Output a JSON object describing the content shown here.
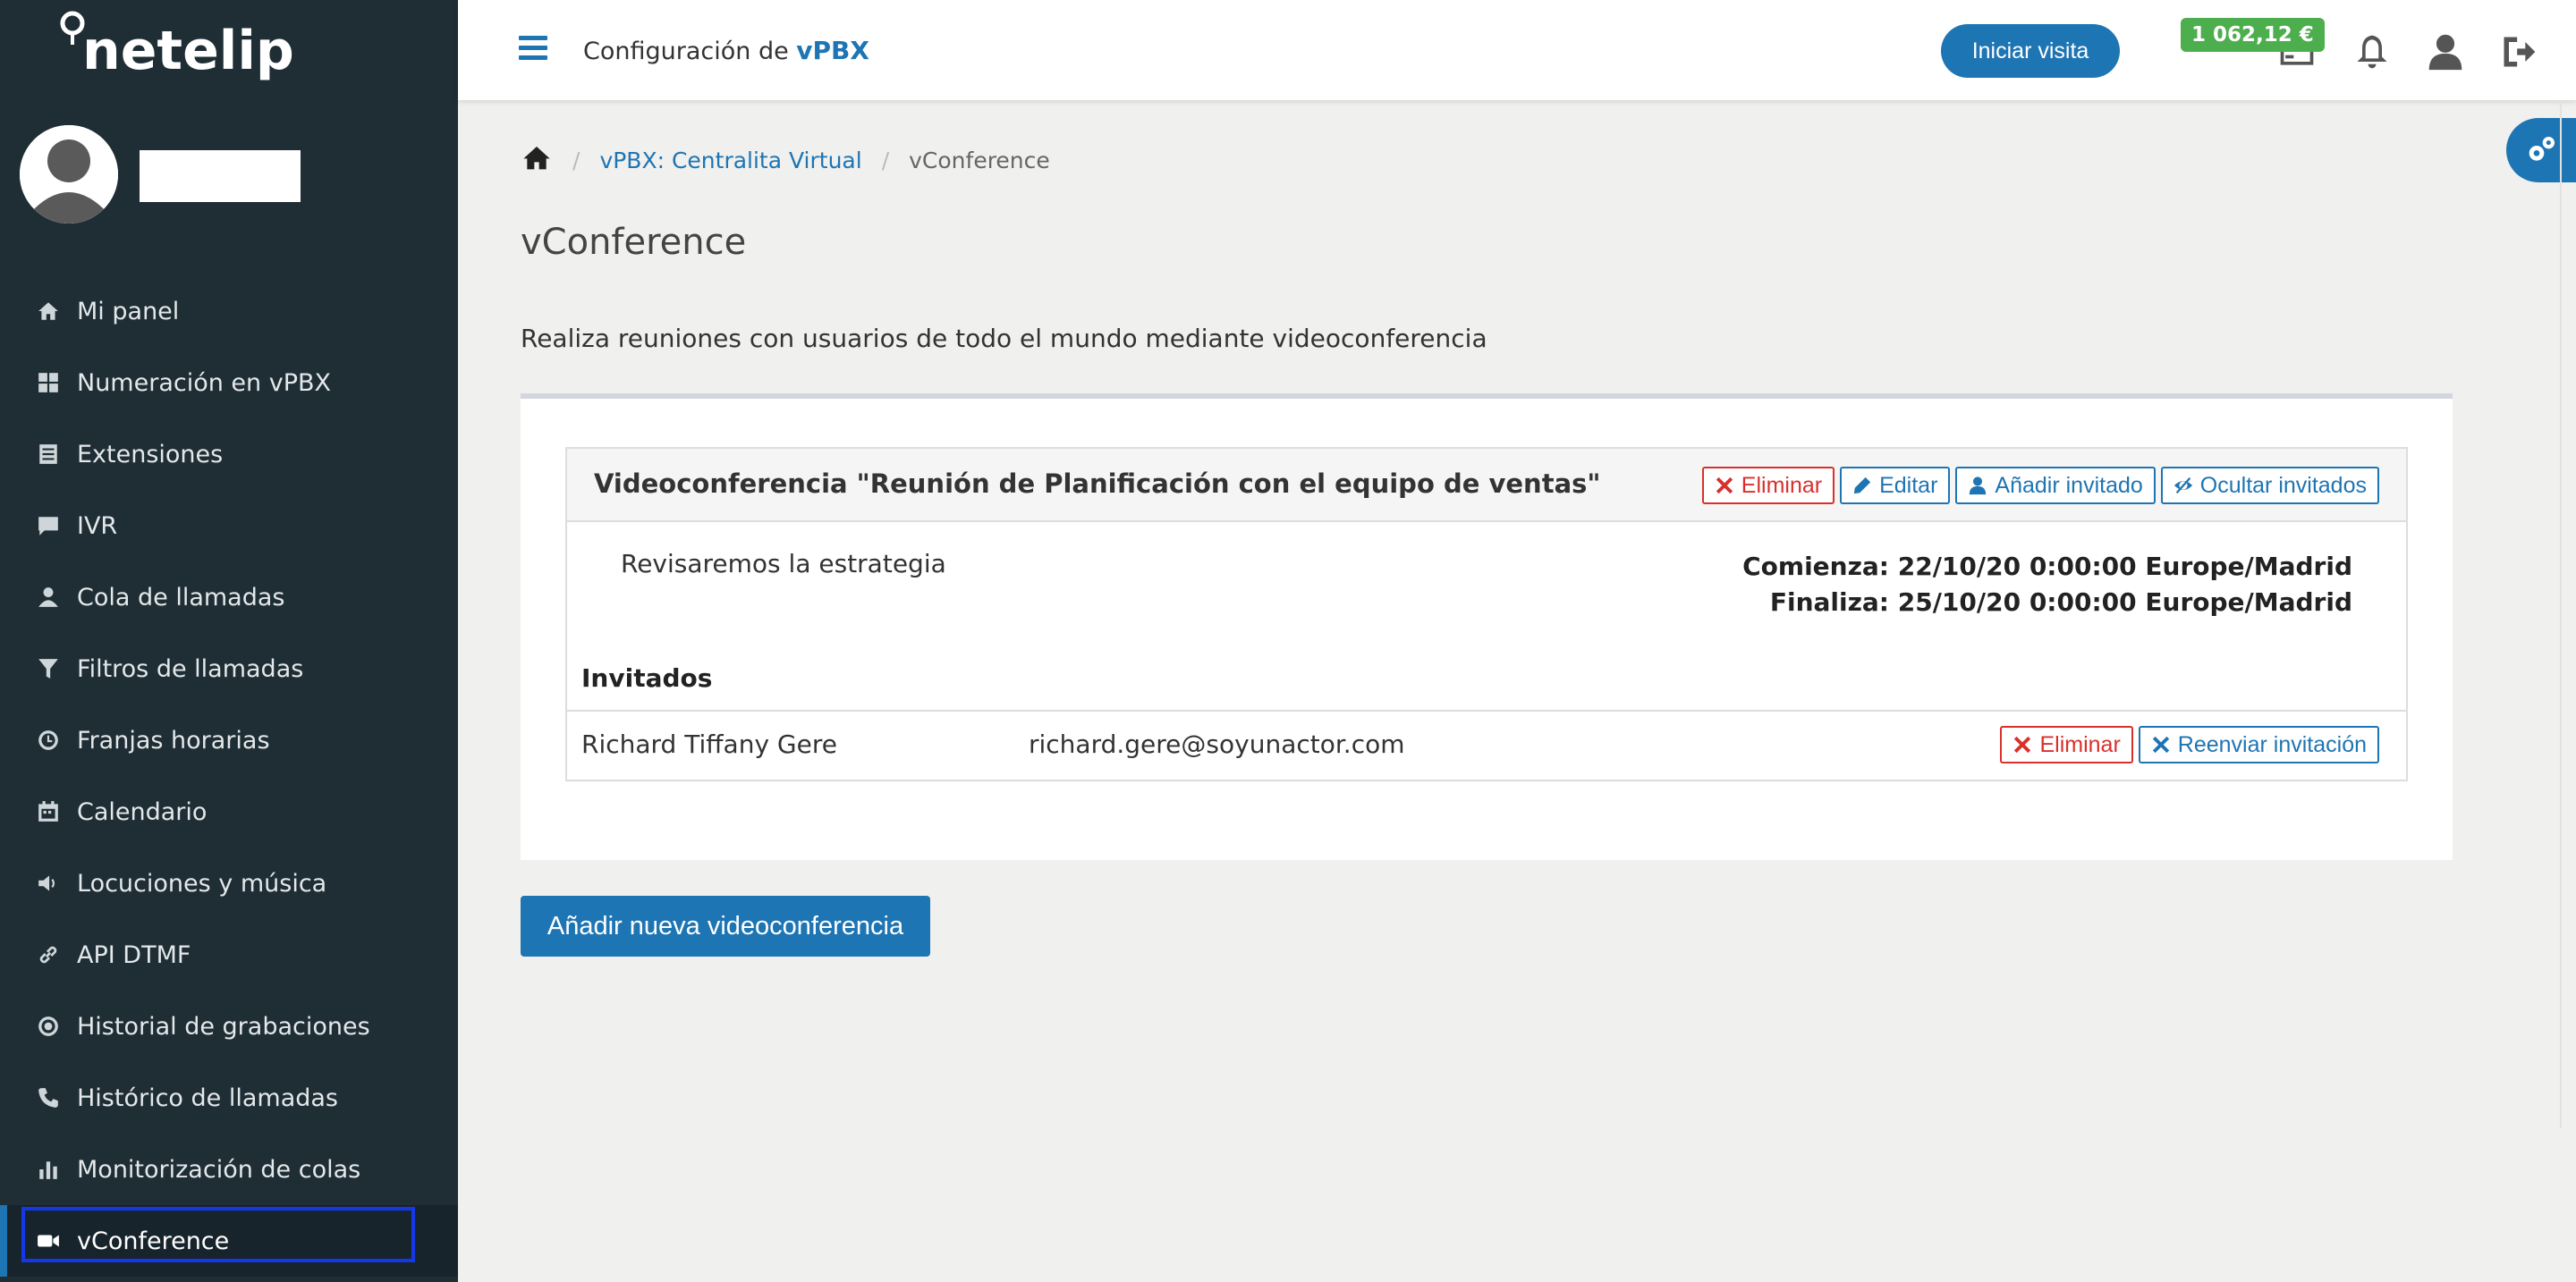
{
  "app": {
    "logo_text": "netelip"
  },
  "sidebar": {
    "items": [
      {
        "label": "Mi panel",
        "icon": "home-icon"
      },
      {
        "label": "Numeración en vPBX",
        "icon": "grid-icon"
      },
      {
        "label": "Extensiones",
        "icon": "list-icon"
      },
      {
        "label": "IVR",
        "icon": "comment-icon"
      },
      {
        "label": "Cola de llamadas",
        "icon": "user-icon"
      },
      {
        "label": "Filtros de llamadas",
        "icon": "filter-icon"
      },
      {
        "label": "Franjas horarias",
        "icon": "clock-icon"
      },
      {
        "label": "Calendario",
        "icon": "calendar-icon"
      },
      {
        "label": "Locuciones y música",
        "icon": "volume-icon"
      },
      {
        "label": "API DTMF",
        "icon": "link-icon"
      },
      {
        "label": "Historial de grabaciones",
        "icon": "record-icon"
      },
      {
        "label": "Histórico de llamadas",
        "icon": "phone-icon"
      },
      {
        "label": "Monitorización de colas",
        "icon": "bar-chart-icon"
      },
      {
        "label": "vConference",
        "icon": "video-icon",
        "active": true
      }
    ]
  },
  "header": {
    "title_prefix": "Configuración de ",
    "title_brand": "vPBX",
    "visit_button": "Iniciar visita",
    "balance": "1 062,12 €"
  },
  "breadcrumb": {
    "link": "vPBX: Centralita Virtual",
    "current": "vConference"
  },
  "page": {
    "title": "vConference",
    "description": "Realiza reuniones con usuarios de todo el mundo mediante videoconferencia"
  },
  "conference": {
    "title": "Videoconferencia \"Reunión de Planificación con el equipo de ventas\"",
    "buttons": {
      "delete": "Eliminar",
      "edit": "Editar",
      "add_guest": "Añadir invitado",
      "hide_guests": "Ocultar invitados"
    },
    "description": "Revisaremos la estrategia",
    "starts": "Comienza: 22/10/20 0:00:00 Europe/Madrid",
    "ends": "Finaliza: 25/10/20 0:00:00 Europe/Madrid",
    "guests_heading": "Invitados",
    "guests": [
      {
        "name": "Richard Tiffany Gere",
        "email": "richard.gere@soyunactor.com",
        "delete": "Eliminar",
        "resend": "Reenviar invitación"
      }
    ]
  },
  "add_button": "Añadir nueva videoconferencia",
  "colors": {
    "sidebar_bg": "#1f2d35",
    "accent": "#1e75b3",
    "danger": "#d9302b",
    "balance": "#4cae4c"
  }
}
